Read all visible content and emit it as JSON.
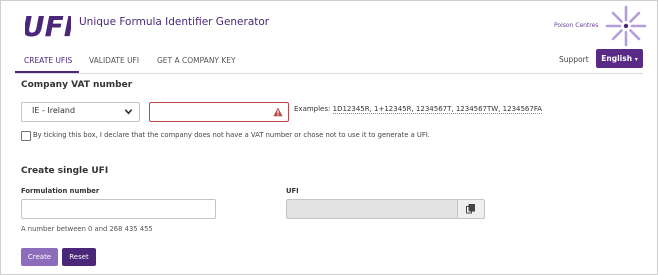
{
  "header": {
    "logo_text": "UFI",
    "app_title": "Unique Formula Identifier Generator",
    "partner_label": "Poison Centres"
  },
  "nav": {
    "tabs": [
      {
        "label": "CREATE UFIS",
        "active": true
      },
      {
        "label": "VALIDATE UFI",
        "active": false
      },
      {
        "label": "GET A COMPANY KEY",
        "active": false
      }
    ],
    "support_label": "Support",
    "language_label": "English"
  },
  "vat_section": {
    "heading": "Company VAT number",
    "country_selected": "IE - Ireland",
    "vat_value": "",
    "examples_prefix": "Examples: ",
    "examples_list": "1D12345R, 1+12345R, 1234567T, 1234567TW, 1234567FA",
    "no_vat_checkbox_label": "By ticking this box, I declare that the company does not have a VAT number or chose not to use it to generate a UFI.",
    "no_vat_checked": false
  },
  "single_ufi": {
    "heading": "Create single UFI",
    "formulation_label": "Formulation number",
    "formulation_value": "",
    "formulation_hint": "A number between 0 and 268 435 455",
    "ufi_label": "UFI",
    "ufi_value": ""
  },
  "actions": {
    "create_label": "Create",
    "reset_label": "Reset"
  },
  "colors": {
    "brand_purple": "#4a2778",
    "button_purple": "#5a2a87",
    "create_button": "#8d6cbb",
    "error_red": "#b94a48",
    "burst_violet": "#b39ddb"
  },
  "icons": [
    "ufi-logo",
    "poison-centres-burst-icon",
    "chevron-down-icon",
    "caret-down-icon",
    "warning-icon",
    "copy-icon"
  ]
}
